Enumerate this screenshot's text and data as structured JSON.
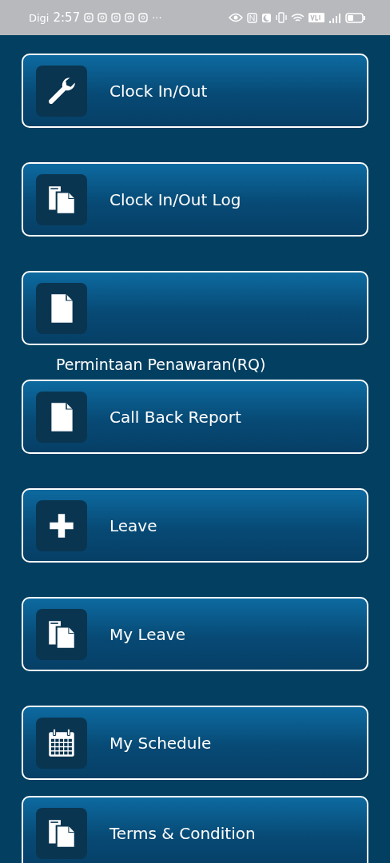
{
  "status_bar": {
    "carrier": "Digi",
    "time": "2:57",
    "more": "···"
  },
  "menu": [
    {
      "kind": "wrench",
      "label": "Clock In/Out"
    },
    {
      "kind": "documents",
      "label": "Clock In/Out Log"
    },
    {
      "kind": "document",
      "caption": "Permintaan Penawaran(RQ)"
    },
    {
      "kind": "document",
      "label": "Call Back Report"
    },
    {
      "kind": "plus",
      "label": "Leave"
    },
    {
      "kind": "documents",
      "label": "My Leave"
    },
    {
      "kind": "calendar",
      "label": "My Schedule"
    },
    {
      "kind": "documents",
      "label": "Terms & Condition"
    }
  ]
}
